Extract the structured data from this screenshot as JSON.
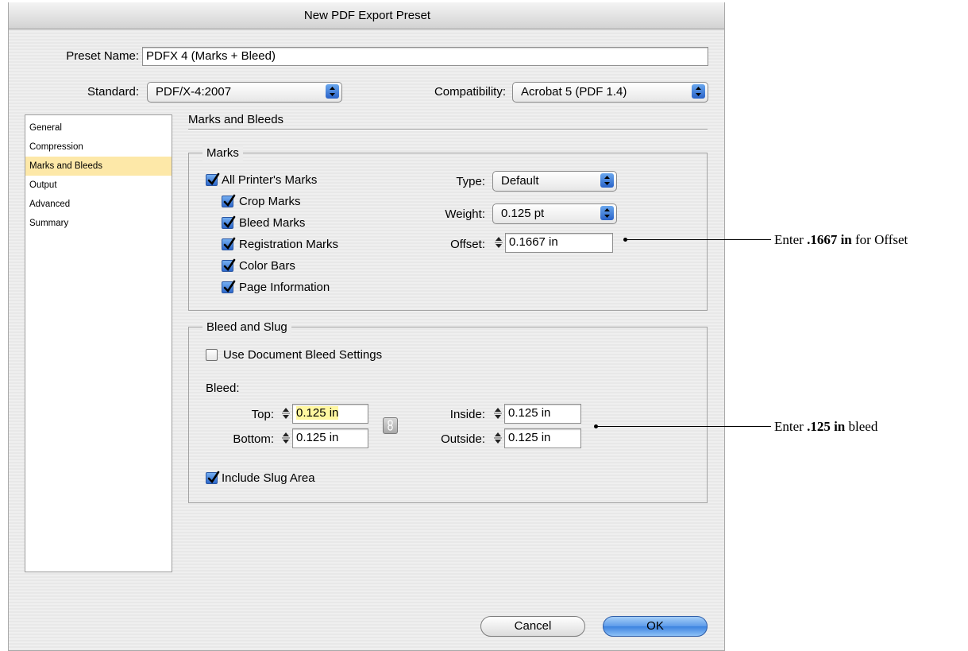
{
  "window": {
    "title": "New PDF Export Preset"
  },
  "preset_name": {
    "label": "Preset Name:",
    "value": "PDFX 4 (Marks + Bleed)"
  },
  "standard": {
    "label": "Standard:",
    "value": "PDF/X-4:2007"
  },
  "compatibility": {
    "label": "Compatibility:",
    "value": "Acrobat 5 (PDF 1.4)"
  },
  "sidebar": {
    "items": [
      {
        "label": "General"
      },
      {
        "label": "Compression"
      },
      {
        "label": "Marks and Bleeds"
      },
      {
        "label": "Output"
      },
      {
        "label": "Advanced"
      },
      {
        "label": "Summary"
      }
    ],
    "selected": "Marks and Bleeds"
  },
  "panel": {
    "title": "Marks and Bleeds"
  },
  "marks": {
    "legend": "Marks",
    "all_printers_marks": "All Printer's Marks",
    "crop_marks": "Crop Marks",
    "bleed_marks": "Bleed Marks",
    "registration_marks": "Registration Marks",
    "color_bars": "Color Bars",
    "page_information": "Page Information",
    "type_label": "Type:",
    "type_value": "Default",
    "weight_label": "Weight:",
    "weight_value": "0.125 pt",
    "offset_label": "Offset:",
    "offset_value": "0.1667 in"
  },
  "bleed_slug": {
    "legend": "Bleed and Slug",
    "use_document_bleed": "Use Document Bleed Settings",
    "bleed_label": "Bleed:",
    "top_label": "Top:",
    "top_value": "0.125 in",
    "bottom_label": "Bottom:",
    "bottom_value": "0.125 in",
    "inside_label": "Inside:",
    "inside_value": "0.125 in",
    "outside_label": "Outside:",
    "outside_value": "0.125 in",
    "include_slug": "Include Slug Area"
  },
  "buttons": {
    "cancel": "Cancel",
    "ok": "OK"
  },
  "callouts": {
    "offset": {
      "prefix": "Enter ",
      "bold": ".1667 in",
      "suffix": " for Offset"
    },
    "bleed": {
      "prefix": "Enter ",
      "bold": ".125 in",
      "suffix": " bleed"
    }
  },
  "colors": {
    "selection": "#fde8a8",
    "highlight_field": "#fff7a0",
    "accent_blue": "#3c82e0"
  }
}
